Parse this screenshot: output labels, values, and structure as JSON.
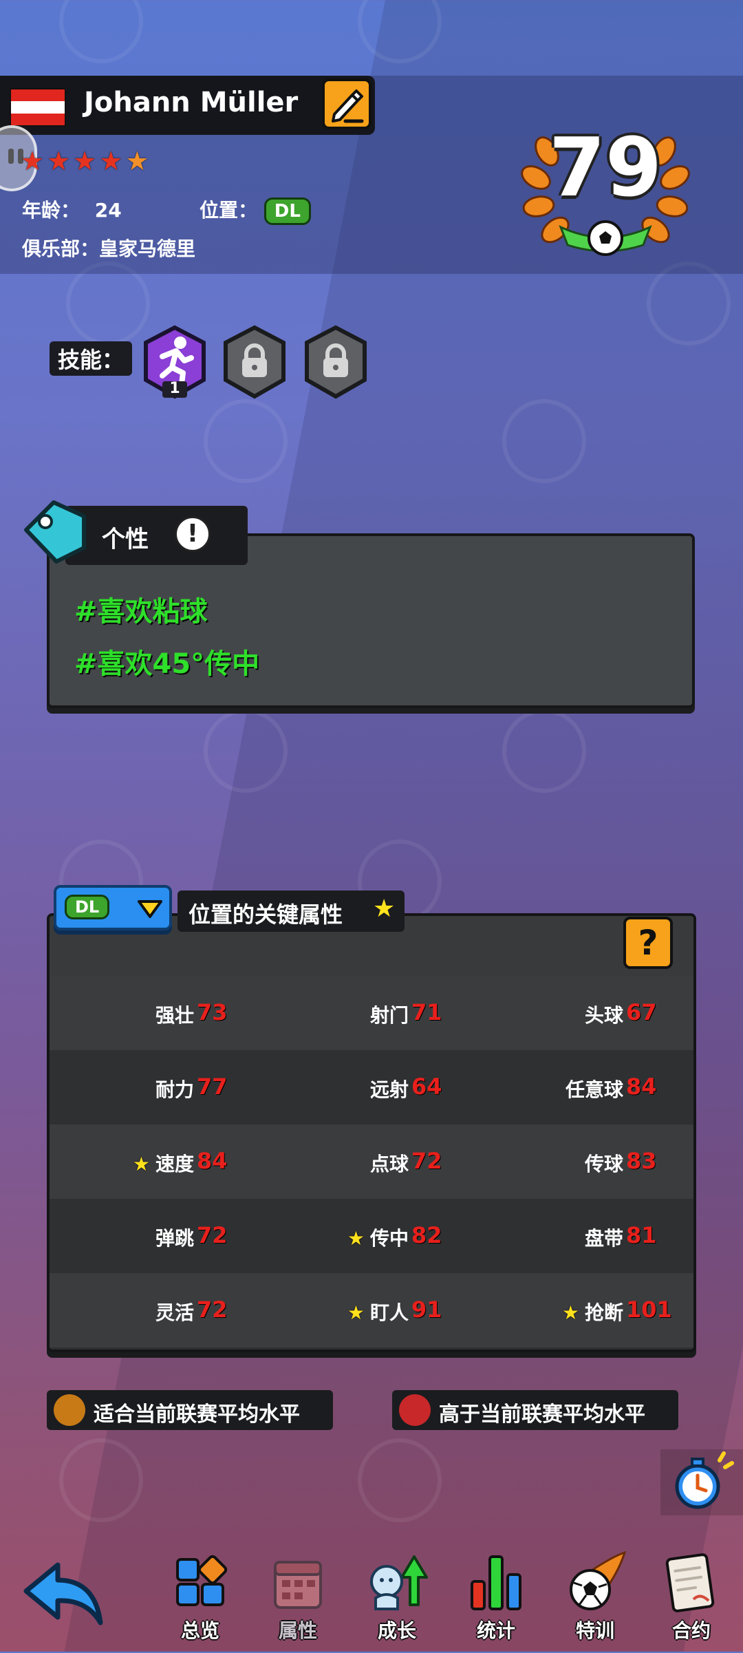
{
  "player": {
    "name": "Johann Müller",
    "flag_colors": [
      "#e0261f",
      "#ffffff",
      "#e0261f"
    ],
    "stars": 4.5,
    "age_label": "年龄：",
    "age": "24",
    "position_label": "位置：",
    "position": "DL",
    "club_label": "俱乐部：",
    "club": "皇家马德里",
    "rating": "79"
  },
  "skills": {
    "label": "技能：",
    "slots": [
      {
        "icon": "running-player-icon",
        "level": "1",
        "locked": false
      },
      {
        "icon": "lock-icon",
        "locked": true
      },
      {
        "icon": "lock-icon",
        "locked": true
      }
    ]
  },
  "personality": {
    "title": "个性",
    "tags": [
      "#喜欢粘球",
      "#喜欢45°传中"
    ]
  },
  "key_attributes": {
    "position": "DL",
    "title": "位置的关键属性",
    "rows": [
      [
        {
          "label": "强壮",
          "value": "73",
          "key": false
        },
        {
          "label": "射门",
          "value": "71",
          "key": false
        },
        {
          "label": "头球",
          "value": "67",
          "key": false
        }
      ],
      [
        {
          "label": "耐力",
          "value": "77",
          "key": false
        },
        {
          "label": "远射",
          "value": "64",
          "key": false
        },
        {
          "label": "任意球",
          "value": "84",
          "key": false
        }
      ],
      [
        {
          "label": "速度",
          "value": "84",
          "key": true
        },
        {
          "label": "点球",
          "value": "72",
          "key": false
        },
        {
          "label": "传球",
          "value": "83",
          "key": false
        }
      ],
      [
        {
          "label": "弹跳",
          "value": "72",
          "key": false
        },
        {
          "label": "传中",
          "value": "82",
          "key": true
        },
        {
          "label": "盘带",
          "value": "81",
          "key": false
        }
      ],
      [
        {
          "label": "灵活",
          "value": "72",
          "key": false
        },
        {
          "label": "盯人",
          "value": "91",
          "key": true
        },
        {
          "label": "抢断",
          "value": "101",
          "key": true
        }
      ]
    ]
  },
  "legend": [
    {
      "text": "适合当前联赛平均水平",
      "color": "#c77a16"
    },
    {
      "text": "高于当前联赛平均水平",
      "color": "#c8282a"
    }
  ],
  "nav": [
    {
      "label": "",
      "icon": "back-arrow-icon"
    },
    {
      "label": "总览",
      "icon": "overview-icon"
    },
    {
      "label": "属性",
      "icon": "attributes-icon"
    },
    {
      "label": "成长",
      "icon": "growth-icon"
    },
    {
      "label": "统计",
      "icon": "stats-icon"
    },
    {
      "label": "特训",
      "icon": "training-icon"
    },
    {
      "label": "合约",
      "icon": "contract-icon"
    }
  ]
}
